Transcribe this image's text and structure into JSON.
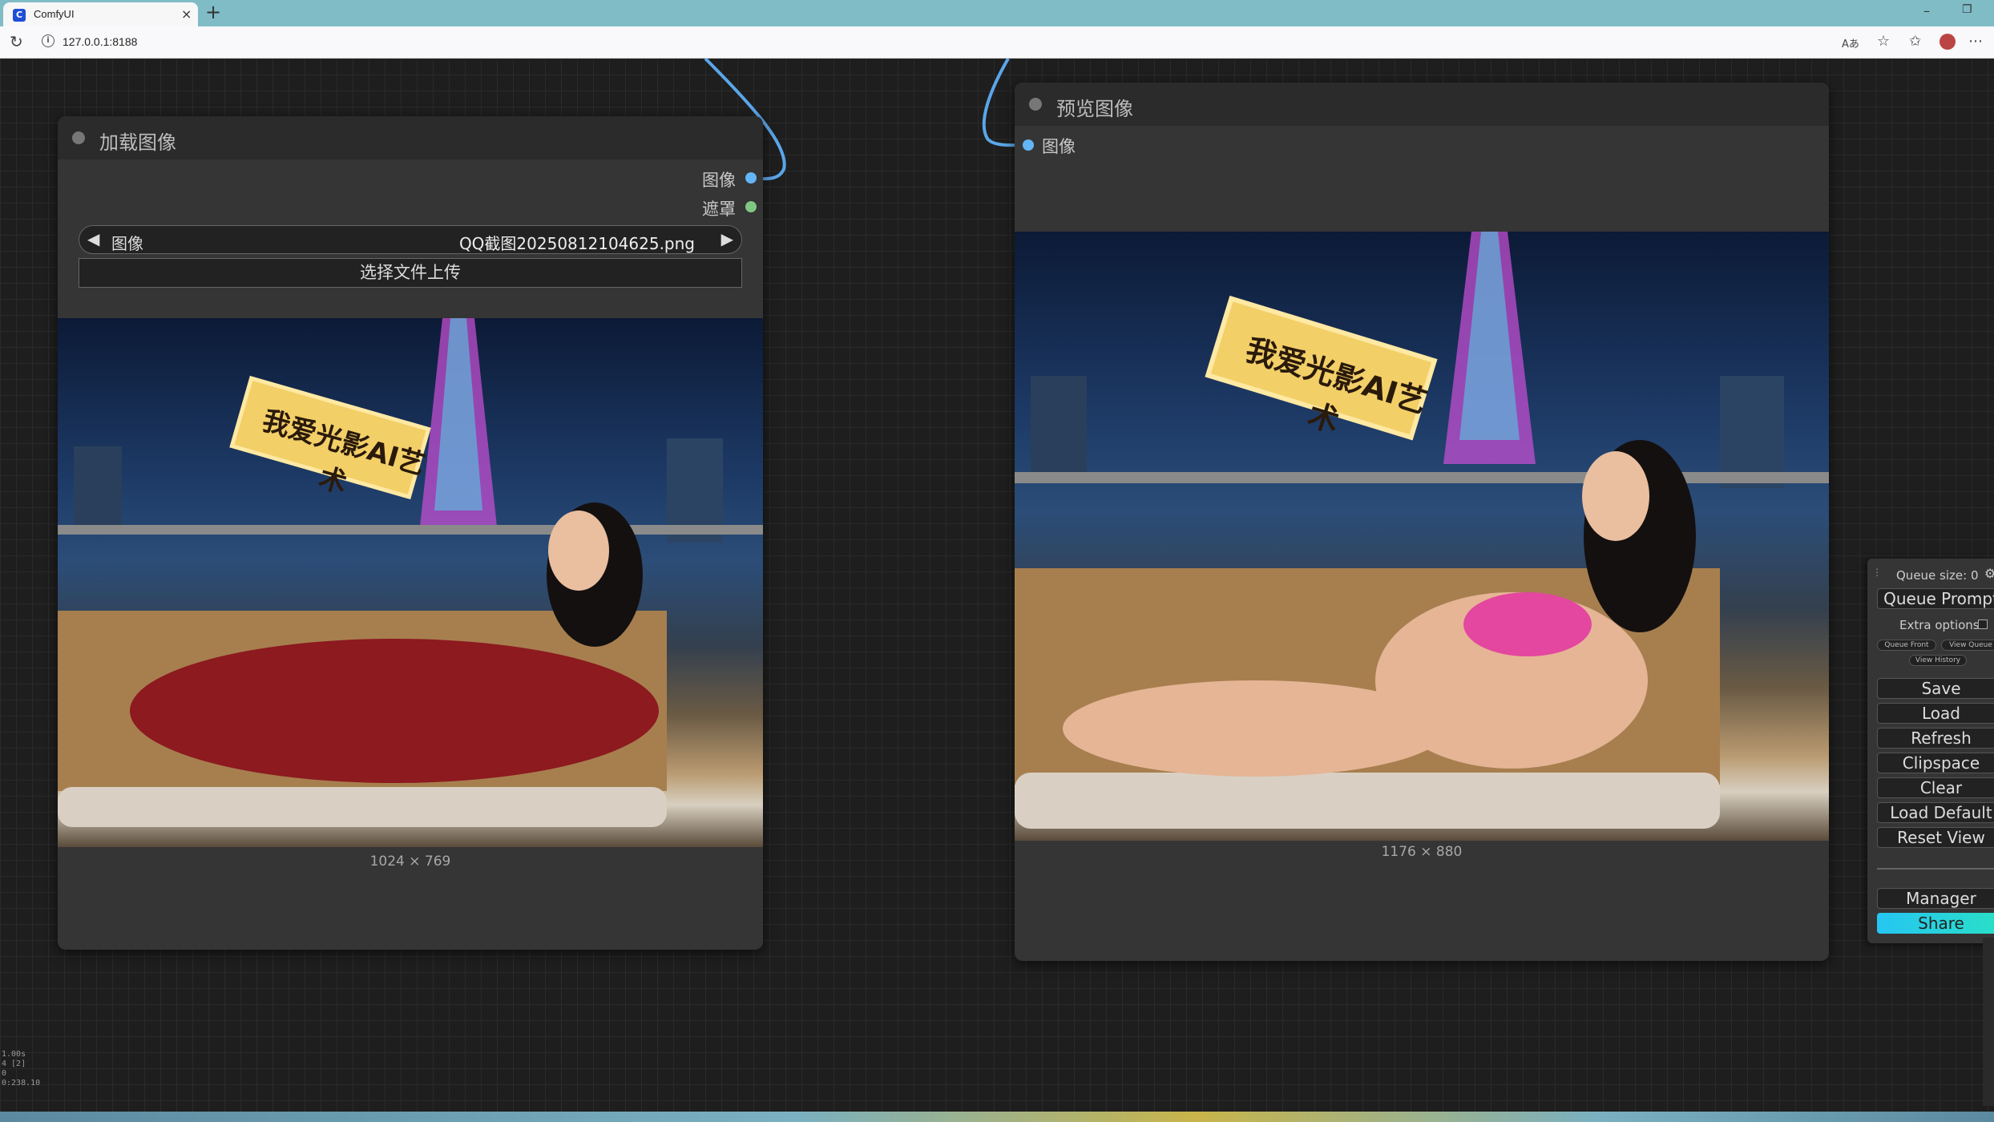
{
  "browser": {
    "tab_title": "ComfyUI",
    "favicon_letter": "C",
    "tab_close": "×",
    "new_tab": "+",
    "url": "127.0.0.1:8188",
    "reload_icon": "↻",
    "minimize": "–",
    "restore": "❐",
    "toolbar_icons": [
      "Aあ",
      "☆",
      "✩",
      "⋯"
    ]
  },
  "load_node": {
    "title": "加载图像",
    "outputs": [
      {
        "label": "图像",
        "color": "#64b5f6"
      },
      {
        "label": "遮罩",
        "color": "#81c784"
      }
    ],
    "image_widget": {
      "name": "图像",
      "value": "QQ截图20250812104625.png",
      "left_arrow": "◀",
      "right_arrow": "▶"
    },
    "upload_label": "选择文件上传",
    "image": {
      "caption": "我爱光影AI艺术",
      "dims": "1024 × 769"
    }
  },
  "preview_node": {
    "title": "预览图像",
    "input": {
      "label": "图像",
      "color": "#64b5f6"
    },
    "image": {
      "caption": "我爱光影AI艺术",
      "dims": "1176 × 880"
    }
  },
  "queue_menu": {
    "drag_handle": "⋮",
    "queue_size": "Queue size: 0",
    "settings_icon": "⚙",
    "queue_prompt": "Queue Prompt",
    "extra_options": "Extra options",
    "queue_front": "Queue Front",
    "view_queue": "View Queue",
    "view_history": "View History",
    "buttons": [
      "Save",
      "Load",
      "Refresh",
      "Clipspace",
      "Clear",
      "Load Default",
      "Reset View"
    ],
    "manager": "Manager",
    "share": "Share"
  },
  "stats": [
    "1.00s",
    "4 [2]",
    "0",
    "0:238.10"
  ],
  "colors": {
    "link": "#5aa6e8",
    "share_accent": "#26c6f2"
  }
}
